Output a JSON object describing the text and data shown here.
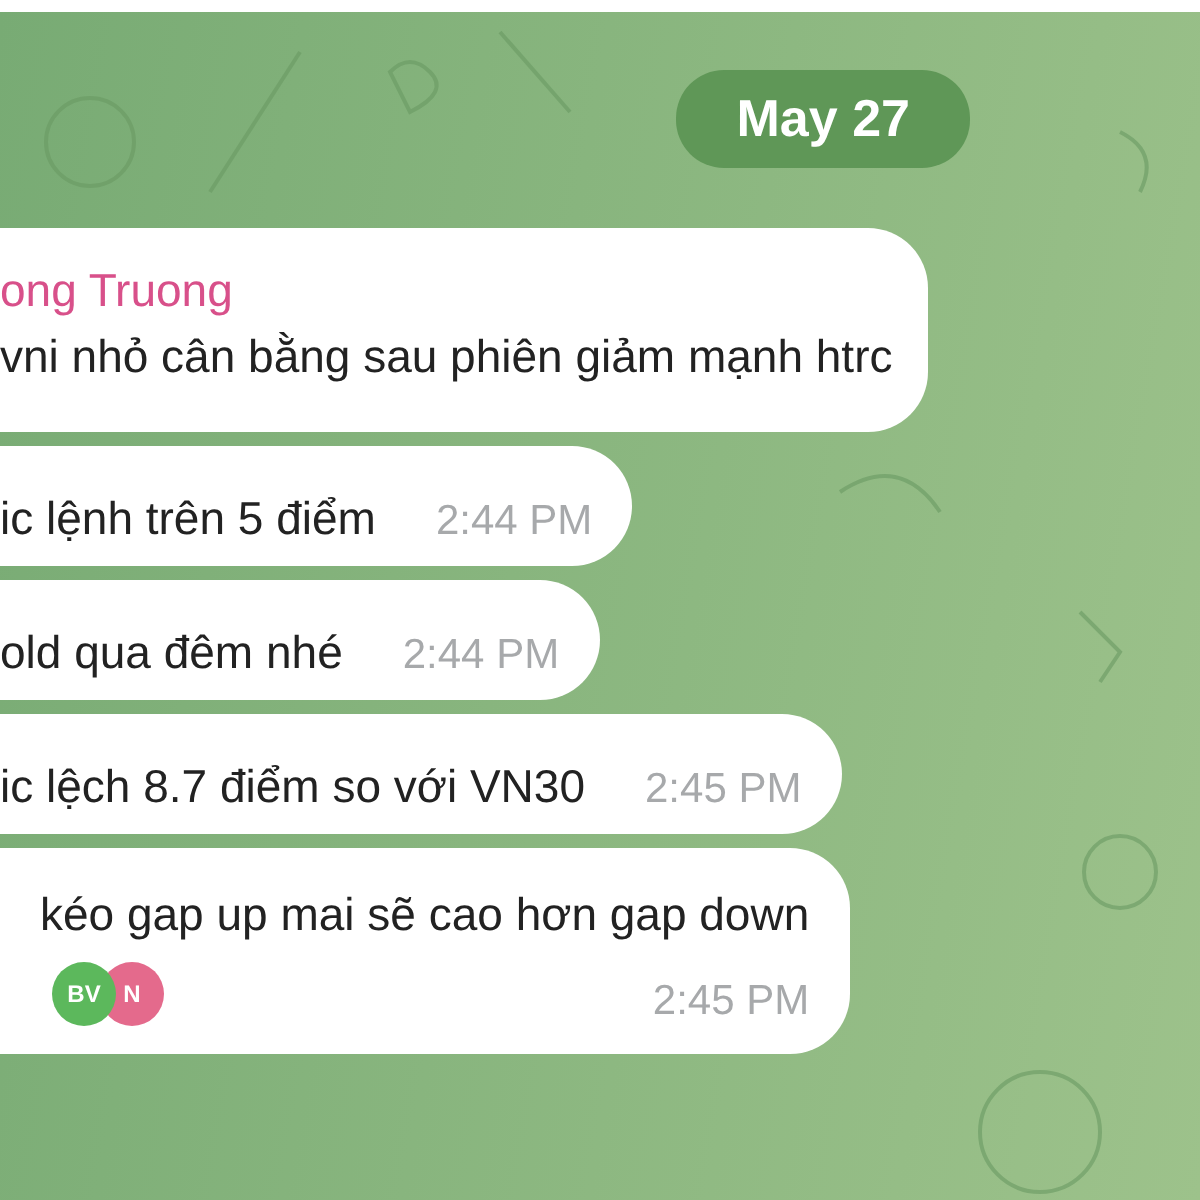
{
  "date_badge": "May 27",
  "messages": [
    {
      "kind": "named",
      "sender": "ong Truong",
      "text": "vni nhỏ cân bằng sau phiên giảm mạnh htrc"
    },
    {
      "kind": "plain",
      "text": "ic lệnh trên 5 điểm",
      "time": "2:44 PM"
    },
    {
      "kind": "plain",
      "text": "old qua đêm nhé",
      "time": "2:44 PM"
    },
    {
      "kind": "plain",
      "text": "ic lệch 8.7 điểm so với VN30",
      "time": "2:45 PM"
    },
    {
      "kind": "reacted",
      "text": "kéo gap up mai sẽ cao hơn gap down",
      "time": "2:45 PM",
      "reactions": [
        {
          "initials": "BV",
          "color": "#5cb85c"
        },
        {
          "initials": "N",
          "color": "#e46a8c"
        }
      ]
    }
  ]
}
